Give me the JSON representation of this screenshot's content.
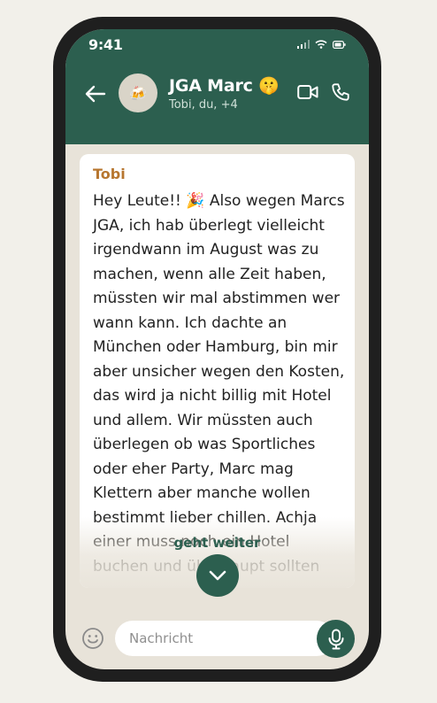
{
  "status_bar": {
    "time": "9:41"
  },
  "chat": {
    "title": "JGA Marc 🤫",
    "subtitle": "Tobi, du, +4",
    "avatar_emoji": "🍻"
  },
  "message": {
    "sender": "Tobi",
    "text": "Hey Leute!! 🎉 Also wegen Marcs JGA, ich hab überlegt vielleicht irgendwann im August was zu machen, wenn alle Zeit haben, müssten wir mal abstimmen wer wann kann. Ich dachte an München oder Hamburg, bin mir aber unsicher wegen den Kosten, das wird ja nicht billig mit Hotel und allem. Wir müssten auch überlegen ob was Sportliches oder eher Party, Marc mag Klettern aber manche wollen bestimmt lieber chillen. Achja einer muss noch ein Hotel buchen und überhaupt sollten"
  },
  "expand": {
    "label": "geht weiter"
  },
  "composer": {
    "placeholder": "Nachricht"
  },
  "colors": {
    "header": "#2c5f4f",
    "sender": "#b7762f",
    "background": "#e8e3d9"
  }
}
